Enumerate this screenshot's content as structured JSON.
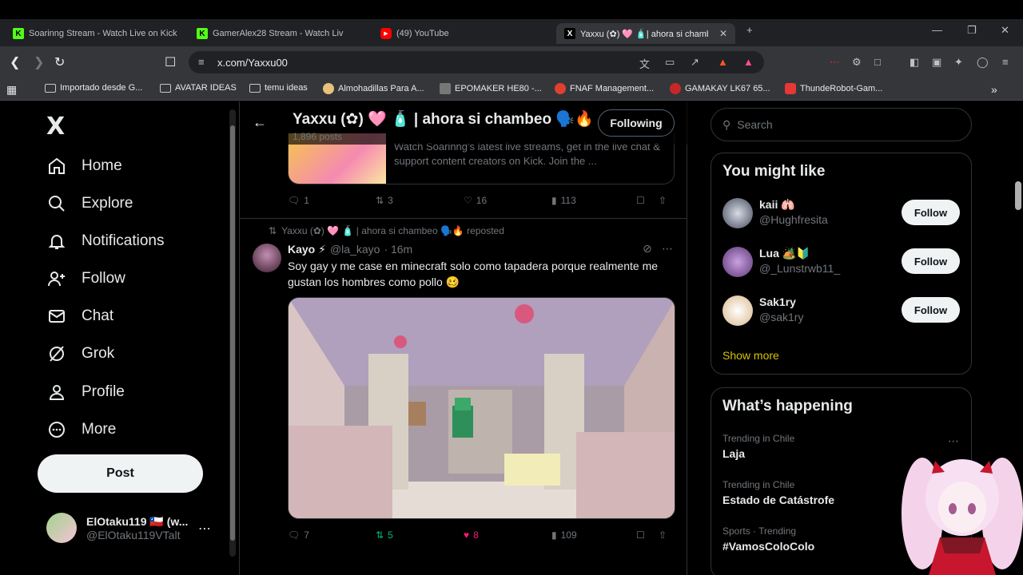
{
  "browser": {
    "tabs": [
      {
        "title": "Soarinng Stream - Watch Live on Kick",
        "icon": "kick-icon"
      },
      {
        "title": "GamerAlex28 Stream - Watch Liv",
        "icon": "kick-icon"
      },
      {
        "title": "(49) YouTube",
        "icon": "youtube-icon"
      },
      {
        "title": "Yaxxu (✿) 🩷 🧴| ahora si chamb",
        "icon": "x-icon"
      }
    ],
    "url": "x.com/Yaxxu00",
    "bookmarks": [
      "Importado desde G...",
      "AVATAR IDEAS",
      "temu ideas",
      "Almohadillas Para A...",
      "EPOMAKER HE80 -...",
      "FNAF Management...",
      "GAMAKAY LK67 65...",
      "ThundeRobot-Gam..."
    ]
  },
  "sidebar": {
    "logo": "X",
    "items": [
      {
        "label": "Home",
        "icon": "home-icon"
      },
      {
        "label": "Explore",
        "icon": "search-icon"
      },
      {
        "label": "Notifications",
        "icon": "bell-icon"
      },
      {
        "label": "Follow",
        "icon": "person-add-icon"
      },
      {
        "label": "Chat",
        "icon": "mail-icon"
      },
      {
        "label": "Grok",
        "icon": "grok-icon"
      },
      {
        "label": "Profile",
        "icon": "person-icon"
      },
      {
        "label": "More",
        "icon": "more-circle-icon"
      }
    ],
    "post_label": "Post",
    "account": {
      "name": "ElOtaku119 🇨🇱 (w...",
      "handle": "@ElOtaku119VTalt"
    }
  },
  "profile_header": {
    "name": "Yaxxu (✿) 🩷 🧴 | ahora si chambeo 🗣️🔥",
    "posts": "1,896 posts",
    "following_label": "Following"
  },
  "feed": {
    "card_text": "Watch Soarinng's latest live streams, get in the live chat & support content creators on Kick. Join the ...",
    "post1_actions": {
      "replies": "1",
      "reposts": "3",
      "likes": "16",
      "views": "113"
    },
    "repost_line": "Yaxxu (✿) 🩷 🧴 | ahora si chambeo 🗣️🔥 reposted",
    "post2": {
      "author": "Kayo ⚡",
      "handle": "@la_kayo",
      "time": "· 16m",
      "text": "Soy gay y me case en minecraft solo como tapadera porque realmente me gustan los hombres como pollo 🥴",
      "replies": "7",
      "reposts": "5",
      "likes": "8",
      "views": "109"
    }
  },
  "right": {
    "search_placeholder": "Search",
    "might_like_title": "You might like",
    "suggestions": [
      {
        "name": "kaii 🫁",
        "handle": "@Hughfresita",
        "follow": "Follow"
      },
      {
        "name": "Lua 🏕️🔰",
        "handle": "@_Lunstrwb11_",
        "follow": "Follow"
      },
      {
        "name": "Sak1ry",
        "handle": "@sak1ry",
        "follow": "Follow"
      }
    ],
    "show_more": "Show more",
    "happening_title": "What’s happening",
    "trends": [
      {
        "context": "Trending in Chile",
        "topic": "Laja"
      },
      {
        "context": "Trending in Chile",
        "topic": "Estado de Catástrofe"
      },
      {
        "context": "Sports · Trending",
        "topic": "#VamosColoColo"
      }
    ]
  }
}
